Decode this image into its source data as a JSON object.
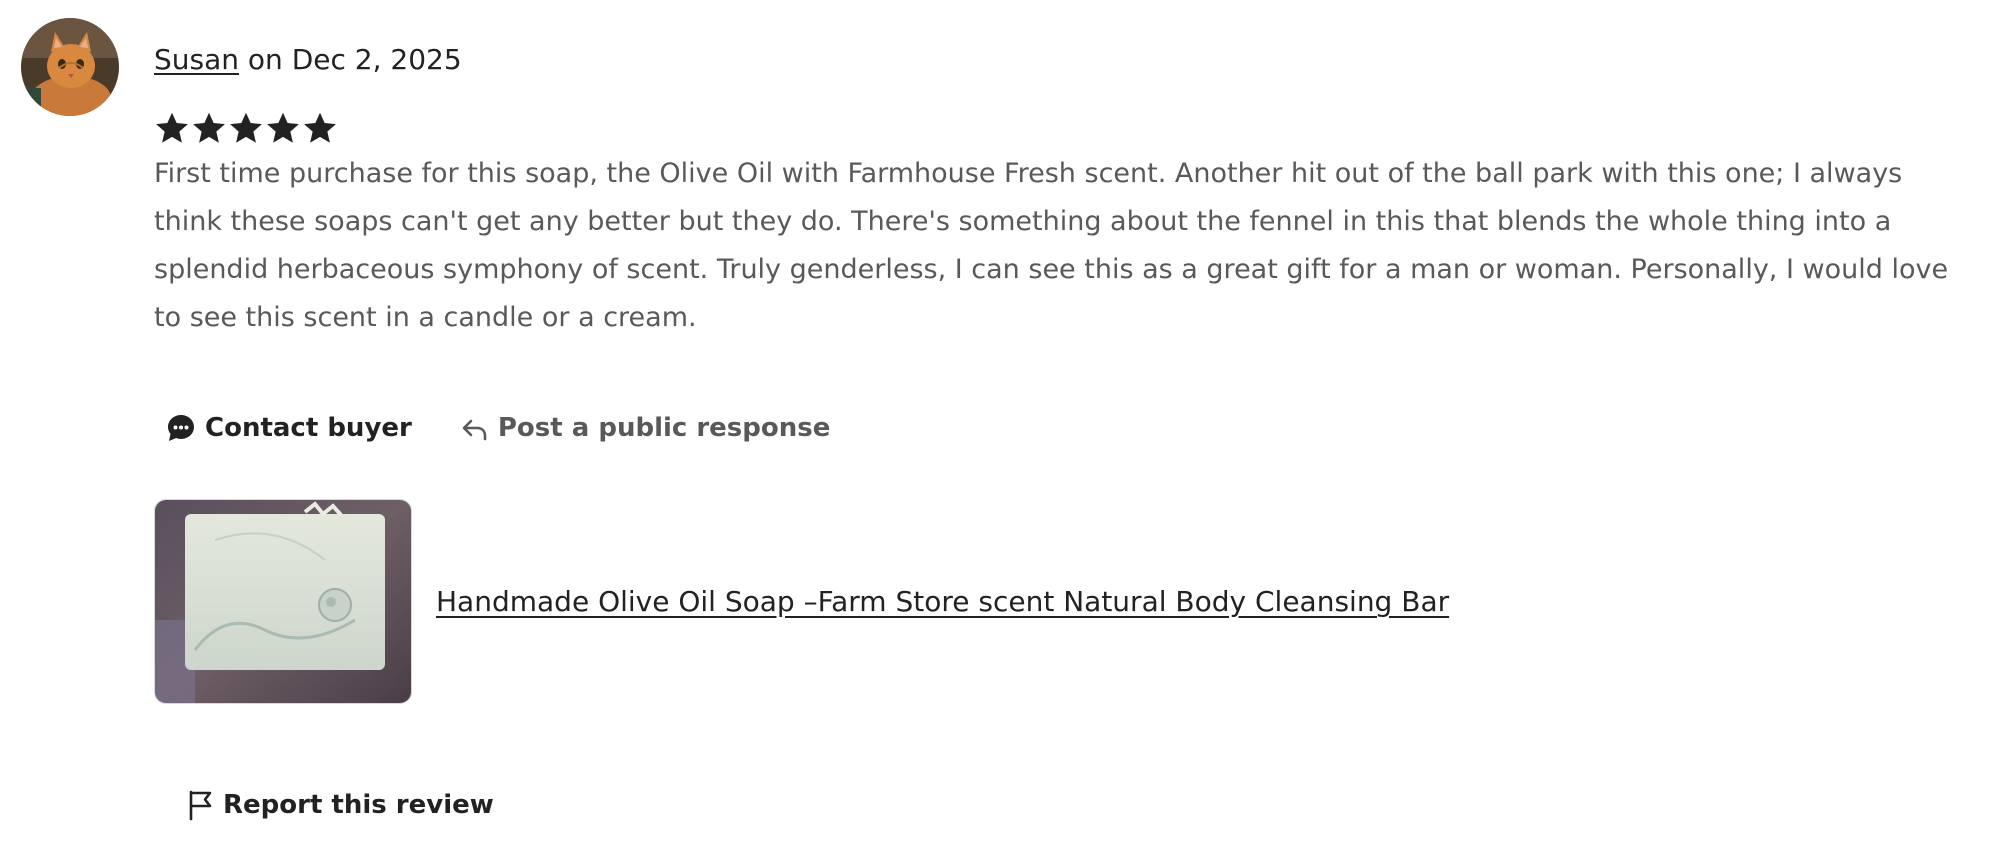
{
  "review": {
    "reviewer_name": "Susan",
    "date_text": " on Dec 2, 2025",
    "rating": 5,
    "body": "First time purchase for this soap, the Olive Oil with Farmhouse Fresh scent. Another hit out of the ball park with this one; I always think these soaps can't get any better but they do. There's something about the fennel in this that blends the whole thing into a splendid herbaceous symphony of scent. Truly genderless, I can see this as a great gift for a man or woman. Personally, I would love to see this scent in a candle or a cream.",
    "actions": {
      "contact_buyer": "Contact buyer",
      "post_response": "Post a public response"
    },
    "product": {
      "title": "Handmade Olive Oil Soap –Farm Store scent Natural Body Cleansing Bar"
    },
    "report_label": "Report this review"
  },
  "icons": {
    "avatar": "cat-photo",
    "star": "star-icon",
    "contact": "chat-bubble-icon",
    "reply": "reply-arrow-icon",
    "report": "flag-icon"
  },
  "colors": {
    "text_primary": "#222222",
    "text_secondary": "#595959",
    "star": "#222222"
  }
}
